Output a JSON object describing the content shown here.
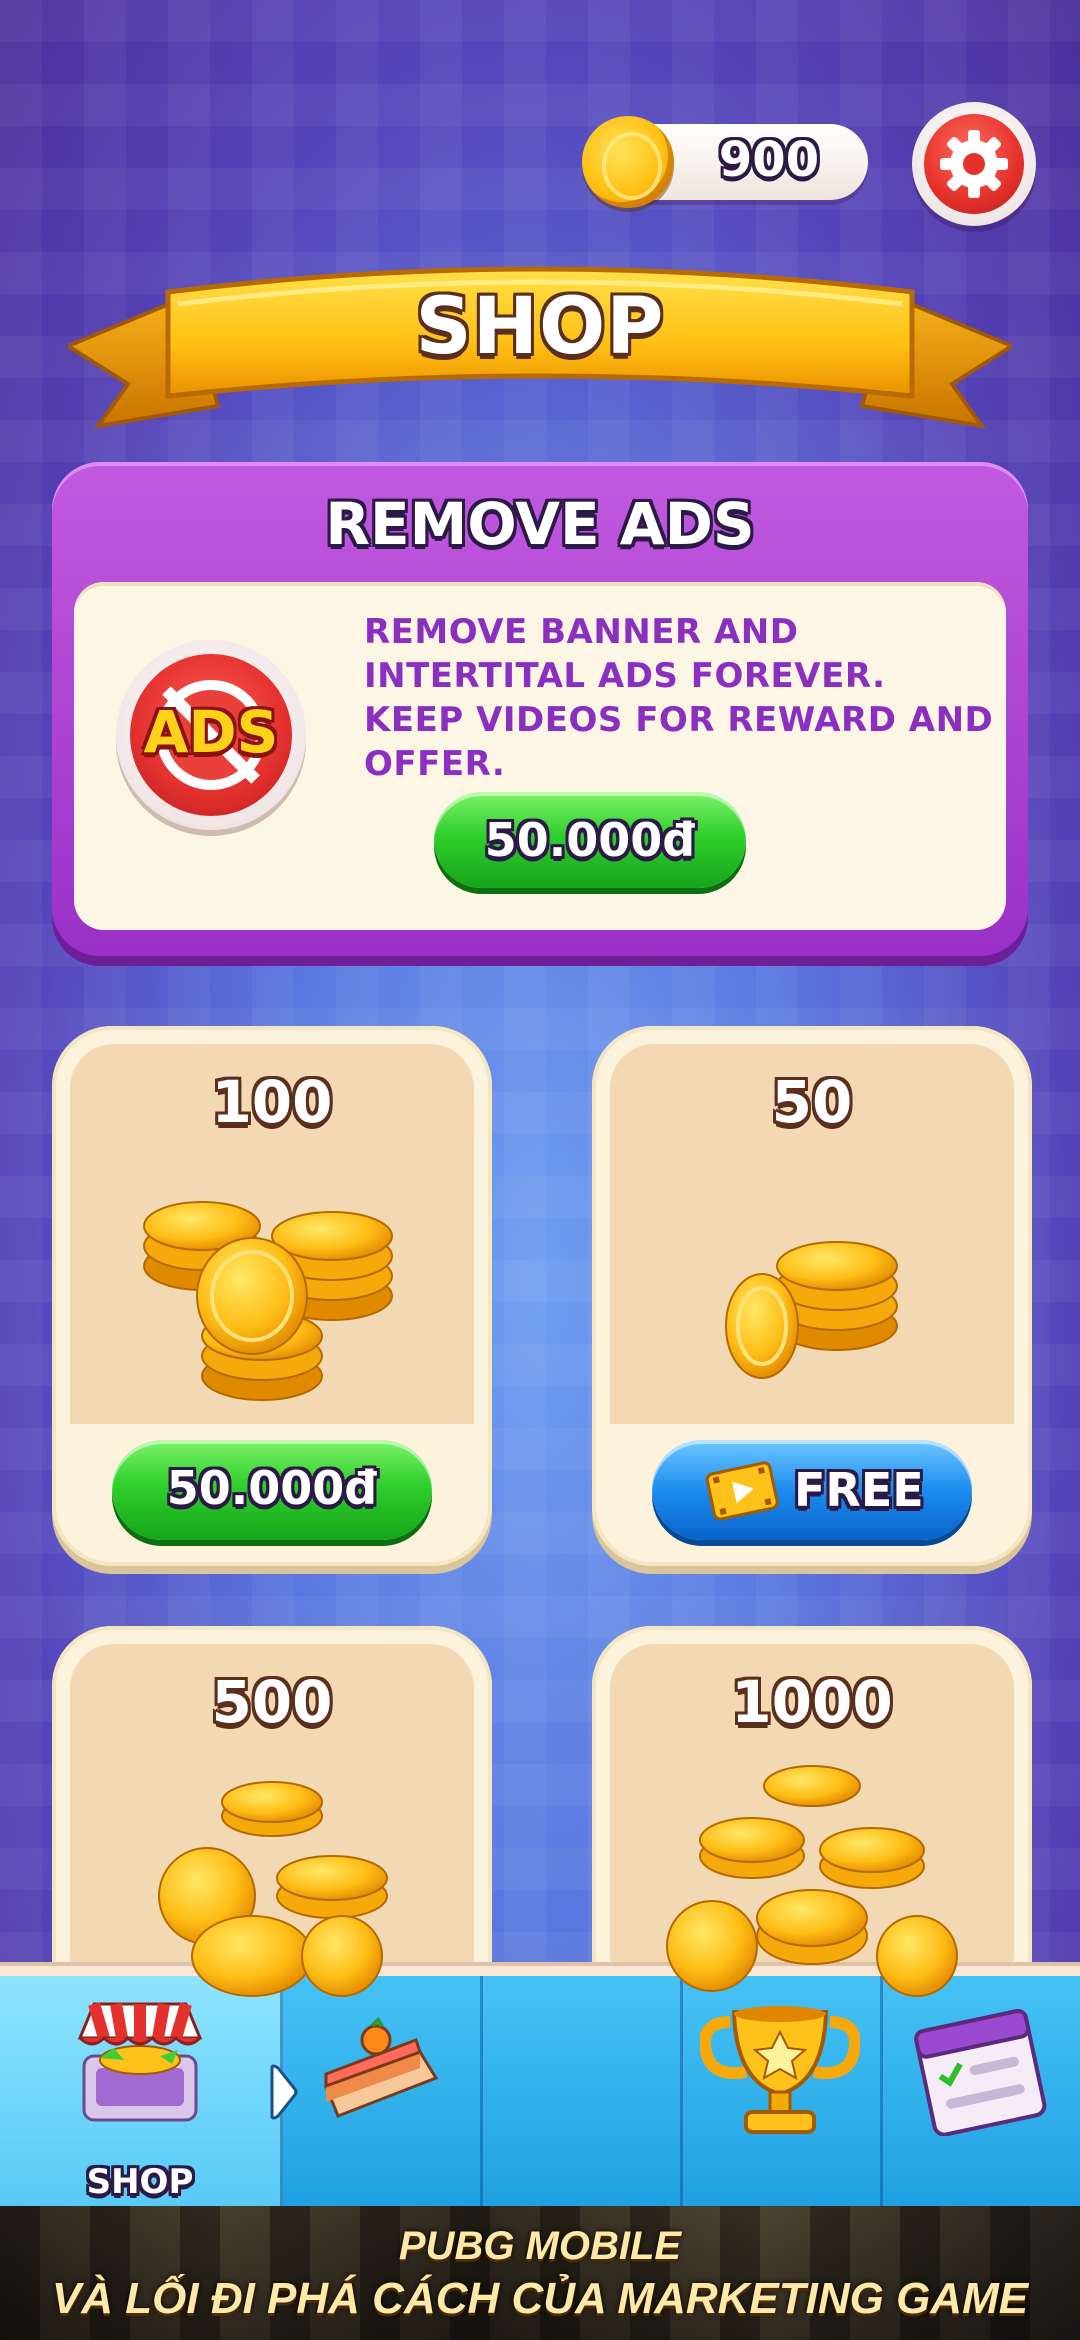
{
  "header": {
    "coin_balance": "900",
    "title": "SHOP"
  },
  "remove_ads": {
    "title": "REMOVE ADS",
    "badge_text": "ADS",
    "description": "REMOVE BANNER AND INTERTITAL ADS FOREVER. KEEP VIDEOS FOR REWARD AND OFFER.",
    "price": "50.000đ"
  },
  "packs": [
    {
      "quantity": "100",
      "price": "50.000đ",
      "type": "purchase"
    },
    {
      "quantity": "50",
      "price": "FREE",
      "type": "video"
    },
    {
      "quantity": "500",
      "type": "purchase"
    },
    {
      "quantity": "1000",
      "type": "purchase"
    }
  ],
  "bottom_nav": {
    "items": [
      {
        "id": "shop",
        "label": "SHOP",
        "icon": "shop-stall-icon",
        "active": true
      },
      {
        "id": "cake",
        "label": "",
        "icon": "cake-icon",
        "active": false
      },
      {
        "id": "empty",
        "label": "",
        "icon": "",
        "active": false
      },
      {
        "id": "trophy",
        "label": "",
        "icon": "trophy-icon",
        "active": false
      },
      {
        "id": "tasks",
        "label": "",
        "icon": "calendar-checklist-icon",
        "active": false
      }
    ]
  },
  "ad_banner": {
    "line1": "PUBG MOBILE",
    "line2": "VÀ LỐI ĐI PHÁ CÁCH CỦA MARKETING GAME"
  },
  "colors": {
    "background": "#5a78e0",
    "ads_panel": "#b04ad6",
    "green_button": "#2fcf2c",
    "blue_button": "#1d8cf0",
    "nav_bar": "#34b3ee",
    "banner_gold": "#ffc21a"
  }
}
